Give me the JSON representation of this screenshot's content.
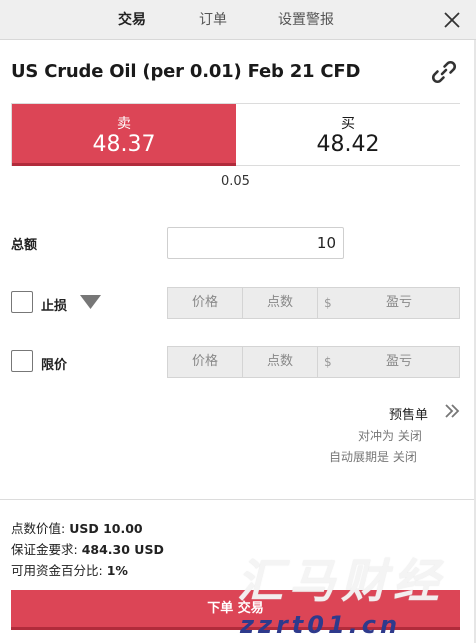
{
  "tabs": [
    {
      "label": "交易",
      "active": true
    },
    {
      "label": "订单",
      "active": false
    },
    {
      "label": "设置警报",
      "active": false
    }
  ],
  "icons": {
    "close": "close-icon",
    "link": "link-icon",
    "dropdown": "triangle-down-icon",
    "pending_expand": "double-chevron-right-icon"
  },
  "instrument": {
    "title": "US Crude Oil (per 0.01) Feb 21 CFD"
  },
  "quote": {
    "sell_label": "卖",
    "sell_price": "48.37",
    "buy_label": "买",
    "buy_price": "48.42",
    "spread": "0.05"
  },
  "amount": {
    "label": "总额",
    "value": "10"
  },
  "stop_loss": {
    "label": "止损",
    "checked": false,
    "price_placeholder": "价格",
    "points_placeholder": "点数",
    "currency_symbol": "$",
    "pl_placeholder": "盈亏"
  },
  "limit": {
    "label": "限价",
    "checked": false,
    "price_placeholder": "价格",
    "points_placeholder": "点数",
    "currency_symbol": "$",
    "pl_placeholder": "盈亏"
  },
  "pending": {
    "label": "预售单",
    "hedging": "对冲为 关闭",
    "rollover": "自动展期是 关闭"
  },
  "summary": {
    "point_value_label": "点数价值:",
    "point_value": "USD 10.00",
    "margin_label": "保证金要求:",
    "margin": "484.30 USD",
    "pct_label": "可用资金百分比:",
    "pct": "1%"
  },
  "submit": {
    "label": "下单 交易"
  },
  "watermark": {
    "main": "汇马财经",
    "sub": "zzrt01.cn"
  },
  "colors": {
    "sell": "#dc4556",
    "sell_shadow": "#b12b3b",
    "topbar": "#efefef",
    "field_bg": "#ececec"
  }
}
